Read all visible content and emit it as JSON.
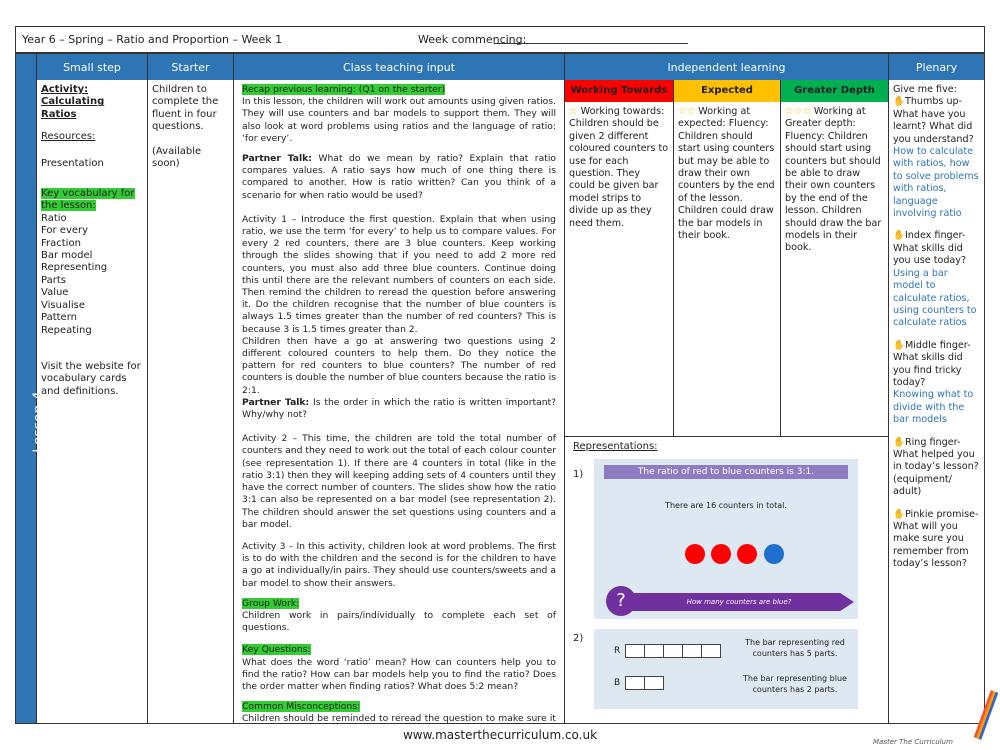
{
  "header": {
    "title": "Year 6 – Spring – Ratio and Proportion – Week 1",
    "week_label": "Week commencing:"
  },
  "lesson_label": "Lesson 4",
  "columns": {
    "small_step": "Small step",
    "starter": "Starter",
    "class_teaching": "Class teaching input",
    "independent": "Independent learning",
    "plenary": "Plenary"
  },
  "small_step": {
    "activity": "Activity: Calculating Ratios",
    "resources_label": "Resources:",
    "presentation": "Presentation",
    "vocab_label": "Key vocabulary for the lesson:",
    "vocab": [
      "Ratio",
      "For every",
      "Fraction",
      "Bar model",
      "Representing",
      "Parts",
      "Value",
      "Visualise",
      "Pattern",
      "Repeating"
    ],
    "website": "Visit the website for vocabulary cards and definitions."
  },
  "starter": {
    "text": "Children to complete the fluent in four questions.",
    "available": "(Available soon)"
  },
  "teaching": {
    "recap_label": "Recap previous learning: (Q1 on the starter)",
    "intro": "In this lesson, the children will work out amounts using given ratios. They will use counters and bar models to support them. They will also look at word problems using ratios and the language of ratio: ‘for every’.",
    "partner1_label": "Partner Talk:",
    "partner1": " What do we mean by ratio? Explain that ratio compares values. A ratio says how much of one thing there is compared to another. How is ratio written? Can you think of a scenario for when ratio would be used?",
    "activity1": "Activity 1 – Introduce the first question. Explain that when using ratio, we use the term ‘for every’ to help us to compare values. For every 2 red counters, there are 3 blue counters. Keep working through the slides showing that if you need to add 2 more red counters, you must also add three blue counters. Continue doing this until there are the relevant numbers of counters on each side. Then remind the children to reread the question before answering it. Do the children recognise that the number of blue counters is always 1.5 times greater than the number of red counters? This is because 3 is 1.5 times greater than 2.",
    "activity1b": "Children then have a go at answering two questions using 2 different coloured counters to help them. Do they notice the pattern for red counters to blue counters? The number of red counters is double the number of blue counters because the ratio is 2:1.",
    "partner2_label": "Partner Talk:",
    "partner2": " Is the order in which the ratio is written important? Why/why not?",
    "activity2": "Activity 2 – This time, the children are told the total number of counters and they need to work out the total of each colour counter (see representation 1). If there are 4 counters in total (like in the ratio 3:1) then they will keeping adding sets of 4 counters until they have the correct number of counters. The slides show how the ratio 3:1 can also be represented on a bar model (see representation 2). The children should answer the set questions using counters and a bar model.",
    "activity3": "Activity 3 – In this activity, children look at word problems. The first is to do with the children and the second is for the children to have a go at individually/in pairs. They should use counters/sweets and a bar model to show their answers.",
    "group_label": "Group Work:",
    "group": "Children work in pairs/individually to complete each set of questions.",
    "keyq_label": "Key Questions:",
    "keyq": "What does the word ‘ratio’ mean? How can counters help you to find the ratio? How can bar models help you to find the ratio? Does the order matter when finding ratios? What does 5:2 mean?",
    "misc_label": "Common Misconceptions:",
    "misc": "Children should be reminded to reread the question to make sure it is fully answered before moving onto the next question."
  },
  "independent": {
    "wt_label": "Working Towards",
    "ex_label": "Expected",
    "gd_label": "Greater Depth",
    "wt": "Working towards: Children should be given 2 different coloured counters to use for each question. They could be given bar model strips to divide up as they need them.",
    "wt_stars": "☆",
    "ex": "Working at expected: Fluency: Children should start using counters but may be able to draw their own counters by the end of the lesson. Children could draw the bar models in their book.",
    "ex_stars": "☆☆",
    "gd": "Working at Greater depth: Fluency: Children should start using counters but should be able to draw their own counters by the end of the lesson. Children should draw the bar models in their book.",
    "gd_stars": "☆☆☆",
    "colors": {
      "wt": "#ff0000",
      "ex": "#ffc000",
      "gd": "#00b050"
    },
    "reps_label": "Representations:",
    "rep1_num": "1)",
    "rep1_title": "The ratio of red to blue counters is 3:1.",
    "rep1_total": "There are 16 counters in total.",
    "rep1_q": "How many counters are blue?",
    "rep1_qmark": "?",
    "rep2_num": "2)",
    "rep2_r": "R",
    "rep2_b": "B",
    "rep2_rtext": "The bar representing red counters has 5 parts.",
    "rep2_btext": "The bar representing blue counters has 2 parts."
  },
  "plenary": {
    "intro": "Give me five:",
    "thumb": "Thumbs up- What have you learnt? What did you understand?",
    "thumb_ans": "How to calculate with ratios, how to solve problems with ratios, language involving ratio",
    "index": "Index finger- What skills did you use today?",
    "index_ans": "Using a bar model to calculate ratios, using counters to calculate ratios",
    "middle": "Middle finger- What skills did you find tricky today?",
    "middle_ans": "Knowing what to divide with the bar models",
    "ring": "Ring finger- What helped you in today’s lesson? (equipment/ adult)",
    "pinkie": "Pinkie promise- What will you make sure you remember from today’s lesson?"
  },
  "footer": {
    "url": "www.masterthecurriculum.co.uk",
    "brand": "Master The Curriculum"
  }
}
